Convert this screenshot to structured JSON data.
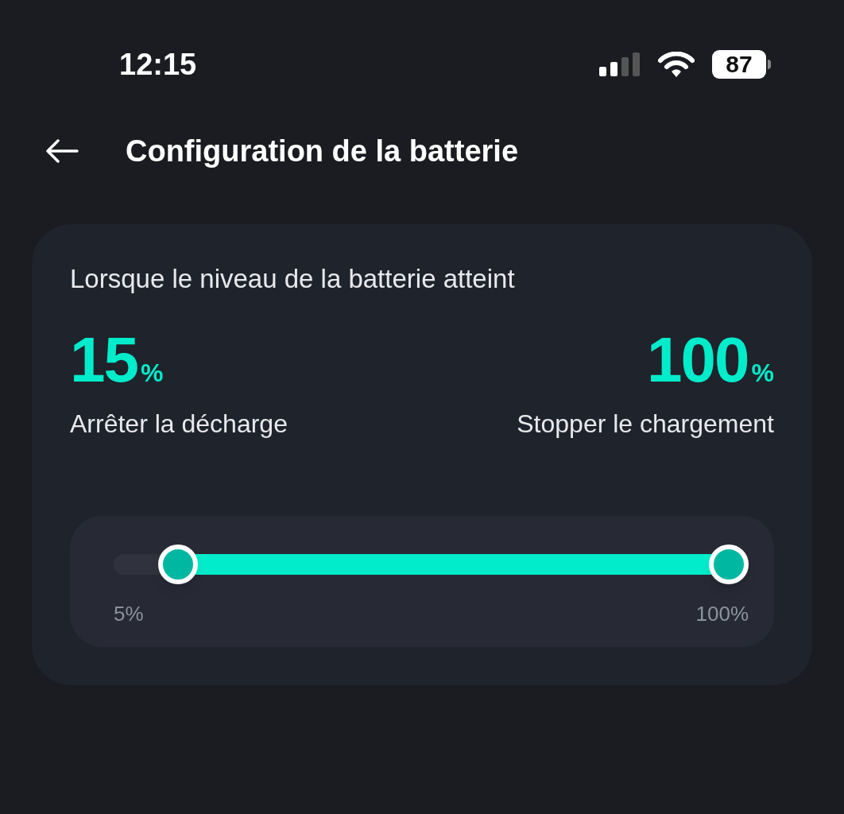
{
  "status_bar": {
    "time": "12:15",
    "battery": "87"
  },
  "header": {
    "title": "Configuration de la batterie"
  },
  "card": {
    "heading": "Lorsque le niveau de la batterie atteint",
    "lower": {
      "value": "15",
      "unit": "%",
      "label": "Arrêter la décharge"
    },
    "upper": {
      "value": "100",
      "unit": "%",
      "label": "Stopper le chargement"
    },
    "slider": {
      "low": {
        "level": 0.105
      },
      "high": {
        "level": 1
      },
      "min_label": "5%",
      "max_label": "100%"
    }
  }
}
